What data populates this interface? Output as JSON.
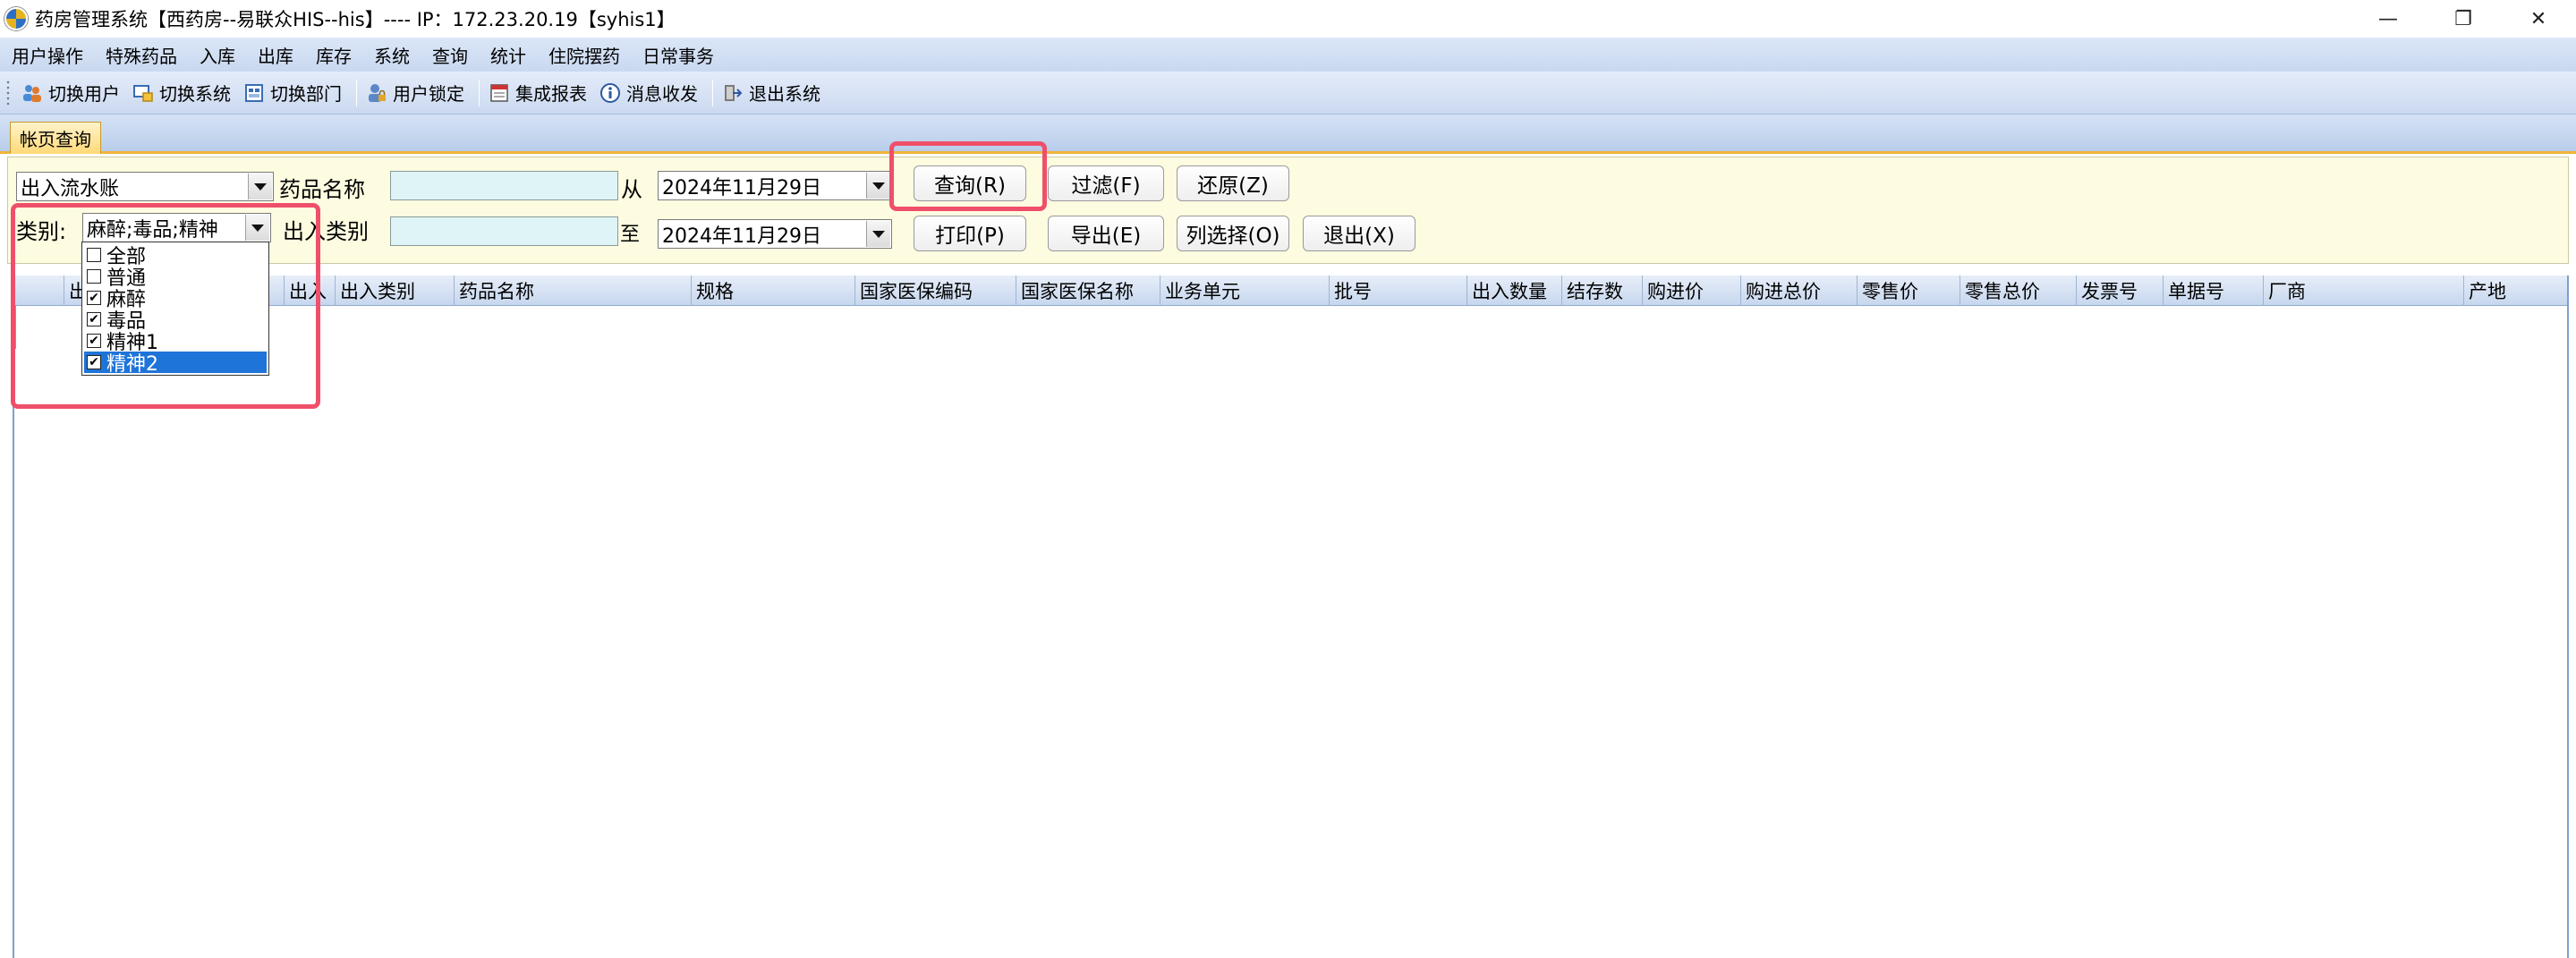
{
  "window": {
    "title": "药房管理系统【西药房--易联众HIS--his】---- IP：172.23.20.19【syhis1】",
    "minimize": "—",
    "restore": "❐",
    "close": "✕"
  },
  "menu": [
    "用户操作",
    "特殊药品",
    "入库",
    "出库",
    "库存",
    "系统",
    "查询",
    "统计",
    "住院摆药",
    "日常事务"
  ],
  "toolbar": {
    "switch_user": "切换用户",
    "switch_system": "切换系统",
    "switch_dept": "切换部门",
    "user_lock": "用户锁定",
    "integrated_report": "集成报表",
    "messages": "消息收发",
    "exit_system": "退出系统"
  },
  "tab": {
    "label": "帐页查询"
  },
  "filter": {
    "report_type_value": "出入流水账",
    "drug_name_label": "药品名称",
    "from_label": "从",
    "from_date": "2024年11月29日",
    "category_label": "类别:",
    "category_value": "麻醉;毒品;精神",
    "inout_type_label": "出入类别",
    "to_label": "至",
    "to_date": "2024年11月29日"
  },
  "buttons": {
    "query": "查询(R)",
    "filter": "过滤(F)",
    "restore": "还原(Z)",
    "print": "打印(P)",
    "export": "导出(E)",
    "columns": "列选择(O)",
    "exit": "退出(X)"
  },
  "category_options": [
    {
      "label": "全部",
      "checked": false
    },
    {
      "label": "普通",
      "checked": false
    },
    {
      "label": "麻醉",
      "checked": true
    },
    {
      "label": "毒品",
      "checked": true
    },
    {
      "label": "精神1",
      "checked": true
    },
    {
      "label": "精神2",
      "checked": true,
      "selected": true
    }
  ],
  "table": {
    "columns": [
      "出",
      "出入",
      "出入类别",
      "药品名称",
      "规格",
      "国家医保编码",
      "国家医保名称",
      "业务单元",
      "批号",
      "出入数量",
      "结存数",
      "购进价",
      "购进总价",
      "零售价",
      "零售总价",
      "发票号",
      "单据号",
      "厂商",
      "产地"
    ]
  },
  "colors": {
    "accent_highlight": "#ef4f6a",
    "selected_item": "#1e74d8",
    "input_bg": "#dff4f6",
    "panel_bg": "#fdfbe0"
  }
}
